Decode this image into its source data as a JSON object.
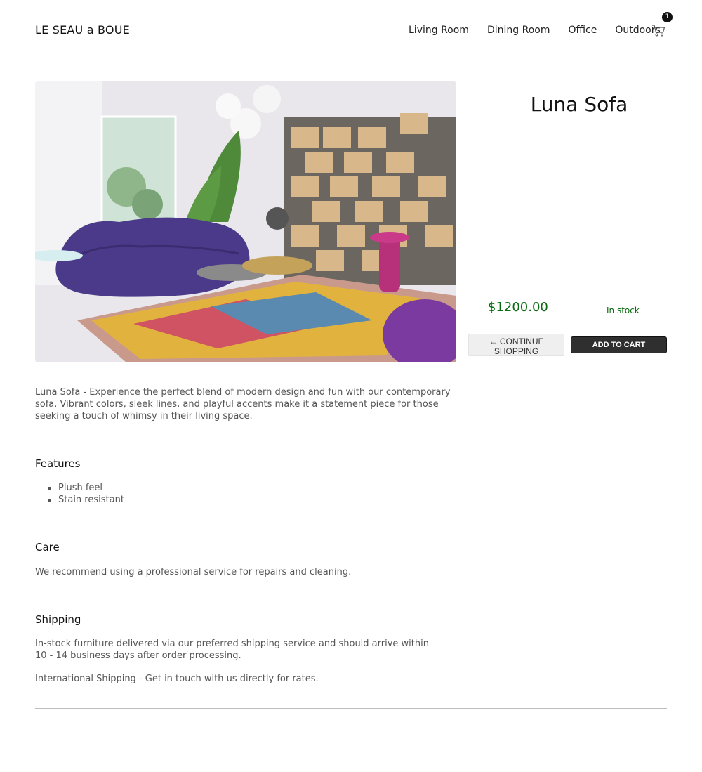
{
  "header": {
    "brand": "LE SEAU a BOUE",
    "nav": [
      "Living Room",
      "Dining Room",
      "Office",
      "Outdoors"
    ],
    "cart_count": "1",
    "cart_icon": "shopping-cart-icon"
  },
  "product": {
    "title": "Luna Sofa",
    "price": "$1200.00",
    "stock": "In stock",
    "continue_label": "← CONTINUE SHOPPING",
    "add_to_cart_label": "ADD TO CART",
    "description": "Luna Sofa - Experience the perfect blend of modern design and fun with our contemporary sofa. Vibrant colors, sleek lines, and playful accents make it a statement piece for those seeking a touch of whimsy in their living space."
  },
  "features": {
    "heading": "Features",
    "items": [
      "Plush feel",
      "Stain resistant"
    ]
  },
  "care": {
    "heading": "Care",
    "text": "We recommend using a professional service for repairs and cleaning."
  },
  "shipping": {
    "heading": "Shipping",
    "text1": "In-stock furniture delivered via our preferred shipping service and should arrive within 10 - 14 business days after order processing.",
    "text2": "International Shipping - Get in touch with us directly for rates."
  },
  "colors": {
    "price_green": "#0a6b10",
    "button_dark": "#2f2f2f",
    "button_light": "#efefef"
  }
}
